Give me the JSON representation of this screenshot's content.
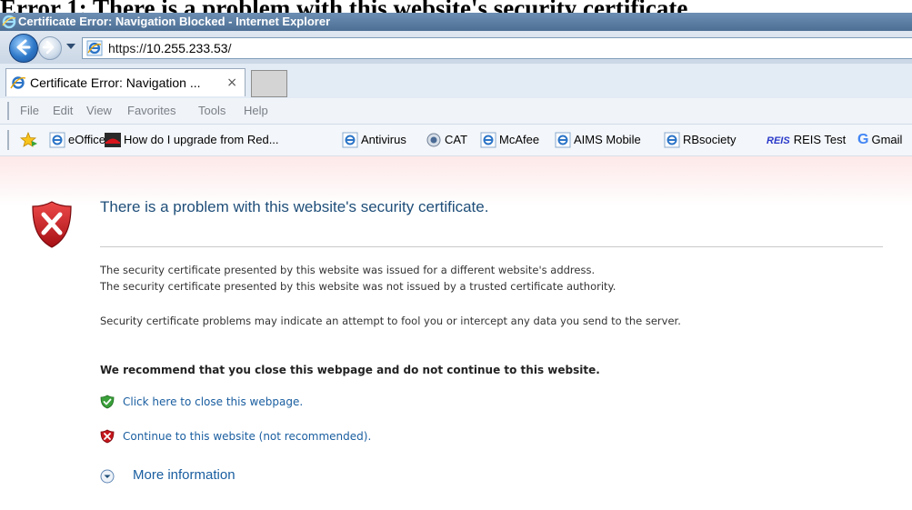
{
  "doc_heading": "Error 1: There is a problem with this website's security certificate",
  "window": {
    "title": "Certificate Error: Navigation Blocked - Internet Explorer"
  },
  "address_bar": {
    "url_prefix": "https://",
    "url_host": "10.255.233.53",
    "url_suffix": "/"
  },
  "tabs": [
    {
      "label": "Certificate Error: Navigation ...",
      "close": "×"
    }
  ],
  "menu": [
    "File",
    "Edit",
    "View",
    "Favorites",
    "Tools",
    "Help"
  ],
  "favorites": [
    {
      "label": "eOffice",
      "icon": "ie-page-icon"
    },
    {
      "label": "How do I upgrade from Red...",
      "icon": "redhat-icon"
    },
    {
      "label": "Antivirus",
      "icon": "ie-page-icon"
    },
    {
      "label": "CAT",
      "icon": "cat-icon"
    },
    {
      "label": "McAfee",
      "icon": "ie-page-icon"
    },
    {
      "label": "AIMS Mobile",
      "icon": "ie-page-icon"
    },
    {
      "label": "RBsociety",
      "icon": "ie-page-icon"
    },
    {
      "label": "REIS Test",
      "icon": "reis-icon",
      "badge": "REIS"
    },
    {
      "label": "Gmail",
      "icon": "google-icon",
      "badge": "G"
    }
  ],
  "content": {
    "title": "There is a problem with this website's security certificate.",
    "para1_line1": "The security certificate presented by this website was issued for a different website's address.",
    "para1_line2": "The security certificate presented by this website was not issued by a trusted certificate authority.",
    "para2": "Security certificate problems may indicate an attempt to fool you or intercept any data you send to the server.",
    "recommend": "We recommend that you close this webpage and do not continue to this website.",
    "close_link": "Click here to close this webpage.",
    "continue_link": "Continue to this website (not recommended).",
    "more_info": "More information"
  },
  "colors": {
    "link": "#1a5ea0",
    "title": "#1f4e79",
    "shield_red": "#c4161c"
  }
}
